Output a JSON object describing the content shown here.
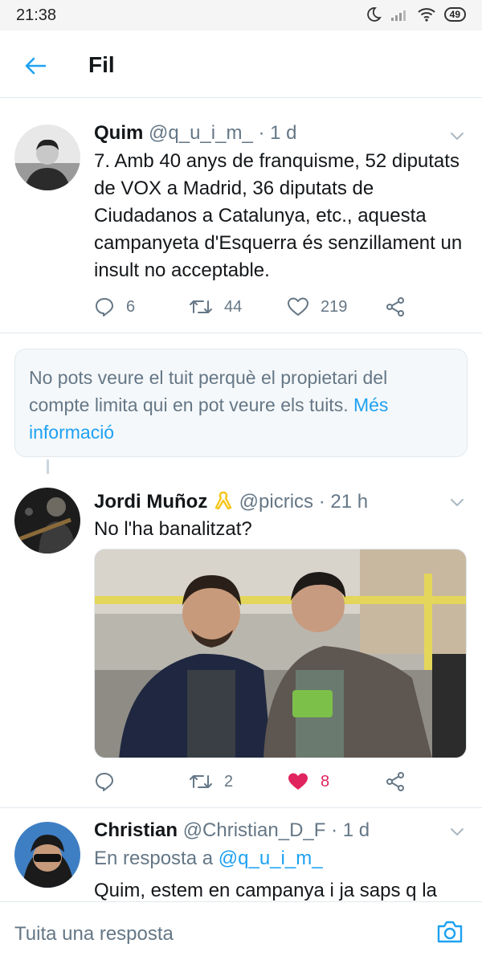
{
  "status_bar": {
    "time": "21:38",
    "battery": "49"
  },
  "header": {
    "title": "Fil"
  },
  "tweets": [
    {
      "name": "Quim",
      "meta": "@q_u_i_m_ · 1 d",
      "text": "7. Amb 40 anys de franquisme, 52 diputats de VOX a Madrid, 36 diputats de Ciudadanos a Catalunya, etc., aquesta campanyeta d'Esquerra és senzillament un insult no acceptable.",
      "replies": "6",
      "retweets": "44",
      "likes": "219"
    },
    {
      "name": "Jordi Muñoz",
      "meta": "@picrics · 21 h",
      "text": "No l'ha banalitzat?",
      "replies": "",
      "retweets": "2",
      "likes": "8"
    },
    {
      "name": "Christian",
      "meta": "@Christian_D_F · 1 d",
      "reply_prefix": "En resposta a",
      "reply_mention": "@q_u_i_m_",
      "text": "Quim, estem en campanya i ja saps q la"
    }
  ],
  "notice": {
    "text": "No pots veure el tuit perquè el propietari del compte limita qui en pot veure els tuits.",
    "link": "Més informació"
  },
  "composer": {
    "placeholder": "Tuita una resposta"
  },
  "icons": {
    "back": "arrow-left-icon",
    "chevron": "chevron-down-icon",
    "reply": "reply-icon",
    "retweet": "retweet-icon",
    "like": "heart-icon",
    "share": "share-icon",
    "camera": "camera-icon"
  },
  "colors": {
    "accent": "#1da1f2",
    "like": "#e0245e",
    "muted": "#657786",
    "divider": "#e1e8ed"
  }
}
